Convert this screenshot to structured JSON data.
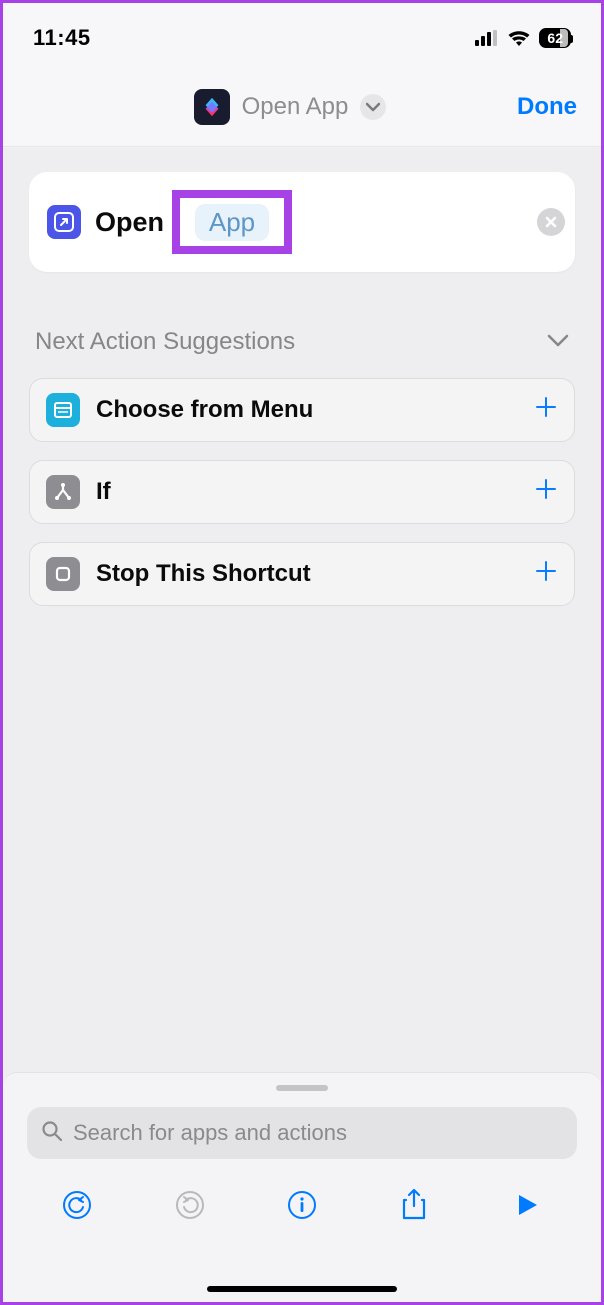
{
  "status": {
    "time": "11:45",
    "battery": "62"
  },
  "header": {
    "title": "Open App",
    "done_label": "Done"
  },
  "action_card": {
    "action_label": "Open",
    "token_label": "App"
  },
  "suggestions": {
    "title": "Next Action Suggestions",
    "items": [
      {
        "label": "Choose from Menu"
      },
      {
        "label": "If"
      },
      {
        "label": "Stop This Shortcut"
      }
    ]
  },
  "search": {
    "placeholder": "Search for apps and actions"
  }
}
